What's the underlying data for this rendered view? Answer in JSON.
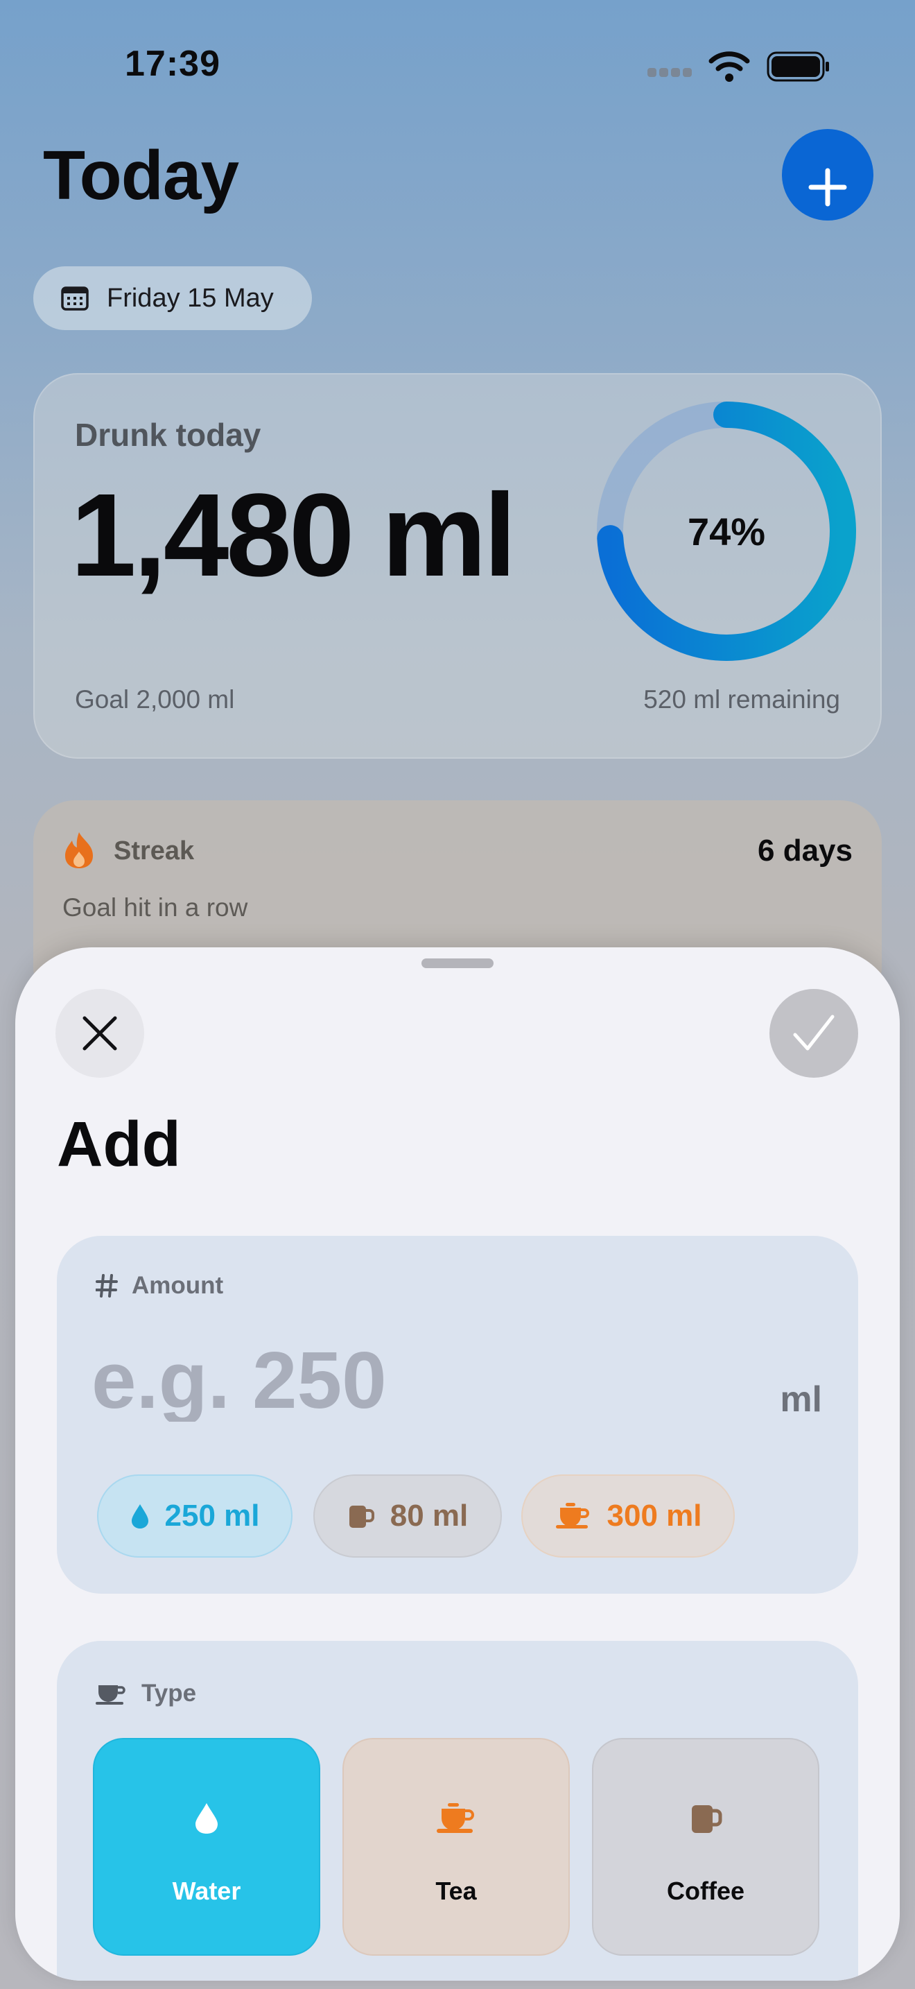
{
  "status_bar": {
    "time": "17:39"
  },
  "header": {
    "title": "Today",
    "add_button_icon": "plus-icon"
  },
  "date_pill": {
    "label": "Friday 15 May",
    "icon": "calendar-icon"
  },
  "summary": {
    "kicker": "Drunk today",
    "amount": "1,480 ml",
    "progress_label": "74%",
    "progress_fraction": 0.74,
    "goal": "Goal 2,000 ml",
    "remaining": "520 ml remaining",
    "ring_color": "#0a78d6"
  },
  "streak": {
    "title": "Streak",
    "days": "6 days",
    "subtitle": "Goal hit in a row",
    "icon": "flame-icon"
  },
  "sheet": {
    "title": "Add",
    "close_icon": "close-icon",
    "confirm_icon": "checkmark-icon",
    "amount": {
      "label": "Amount",
      "icon": "hash-icon",
      "placeholder": "e.g. 250",
      "unit": "ml",
      "presets": [
        {
          "label": "250 ml",
          "icon": "water-drop-icon",
          "color": "#1aa7d8"
        },
        {
          "label": "80 ml",
          "icon": "coffee-mug-icon",
          "color": "#8a6a52"
        },
        {
          "label": "300 ml",
          "icon": "tea-cup-icon",
          "color": "#ee7b1f"
        }
      ]
    },
    "type": {
      "label": "Type",
      "icon": "cup-icon",
      "options": [
        {
          "label": "Water",
          "icon": "water-drop-icon",
          "selected": true,
          "color": "#27c3e8"
        },
        {
          "label": "Tea",
          "icon": "tea-cup-icon",
          "selected": false,
          "color": "#ee7b1f"
        },
        {
          "label": "Coffee",
          "icon": "coffee-mug-icon",
          "selected": false,
          "color": "#8a6a52"
        }
      ]
    }
  }
}
